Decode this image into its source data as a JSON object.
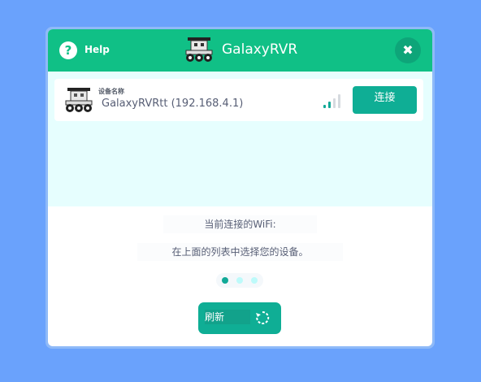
{
  "header": {
    "help_label": "Help",
    "help_icon_glyph": "?",
    "title": "GalaxyRVR",
    "close_glyph": "✖"
  },
  "device": {
    "caption": "设备名称",
    "name": "GalaxyRVRtt (192.168.4.1)",
    "connect_label": "连接",
    "signal_icon": "wifi-signal-icon"
  },
  "status": {
    "wifi_text": "当前连接的WiFi:",
    "hint_text": "在上面的列表中选择您的设备。"
  },
  "pagination": {
    "active_index": 0,
    "count": 3
  },
  "refresh": {
    "label": "刷新",
    "icon": "refresh-icon"
  },
  "colors": {
    "background": "#6aa2fc",
    "header": "#10c086",
    "accent": "#0fae95",
    "device_area": "#e6fefe",
    "dot_active": "#11a997",
    "dot_inactive": "#bdfafa"
  }
}
